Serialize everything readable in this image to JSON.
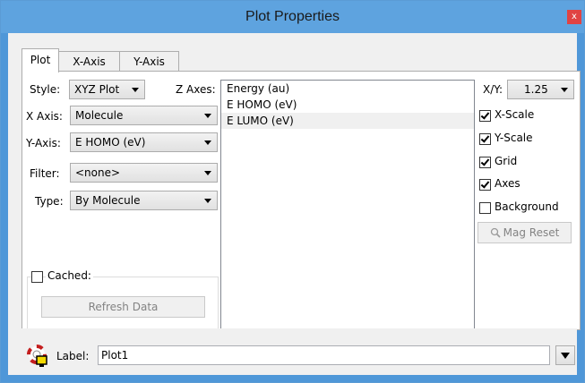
{
  "window": {
    "title": "Plot Properties",
    "close_glyph": "x"
  },
  "tabs": [
    {
      "label": "Plot",
      "active": true
    },
    {
      "label": "X-Axis",
      "active": false
    },
    {
      "label": "Y-Axis",
      "active": false
    }
  ],
  "form": {
    "style": {
      "label": "Style:",
      "value": "XYZ Plot"
    },
    "x_axis": {
      "label": "X Axis:",
      "value": "Molecule"
    },
    "y_axis": {
      "label": "Y-Axis:",
      "value": "E HOMO (eV)"
    },
    "filter": {
      "label": "Filter:",
      "value": "<none>"
    },
    "type": {
      "label": "Type:",
      "value": "By Molecule"
    }
  },
  "z_axes": {
    "label": "Z Axes:",
    "items": [
      {
        "label": "Energy (au)",
        "selected": false
      },
      {
        "label": "E HOMO (eV)",
        "selected": false
      },
      {
        "label": "E LUMO (eV)",
        "selected": true
      }
    ]
  },
  "right": {
    "xy_label": "X/Y:",
    "xy_value": "1.25",
    "checks": [
      {
        "label": "X-Scale",
        "checked": true
      },
      {
        "label": "Y-Scale",
        "checked": true
      },
      {
        "label": "Grid",
        "checked": true
      },
      {
        "label": "Axes",
        "checked": true
      },
      {
        "label": "Background",
        "checked": false
      }
    ],
    "mag_reset": "Mag Reset"
  },
  "cache": {
    "label": "Cached:",
    "checked": false,
    "refresh": "Refresh Data"
  },
  "bottom": {
    "label": "Label:",
    "value": "Plot1"
  },
  "colors": {
    "titlebar": "#5ea3df",
    "close": "#e04343",
    "border": "#4f97d8"
  }
}
